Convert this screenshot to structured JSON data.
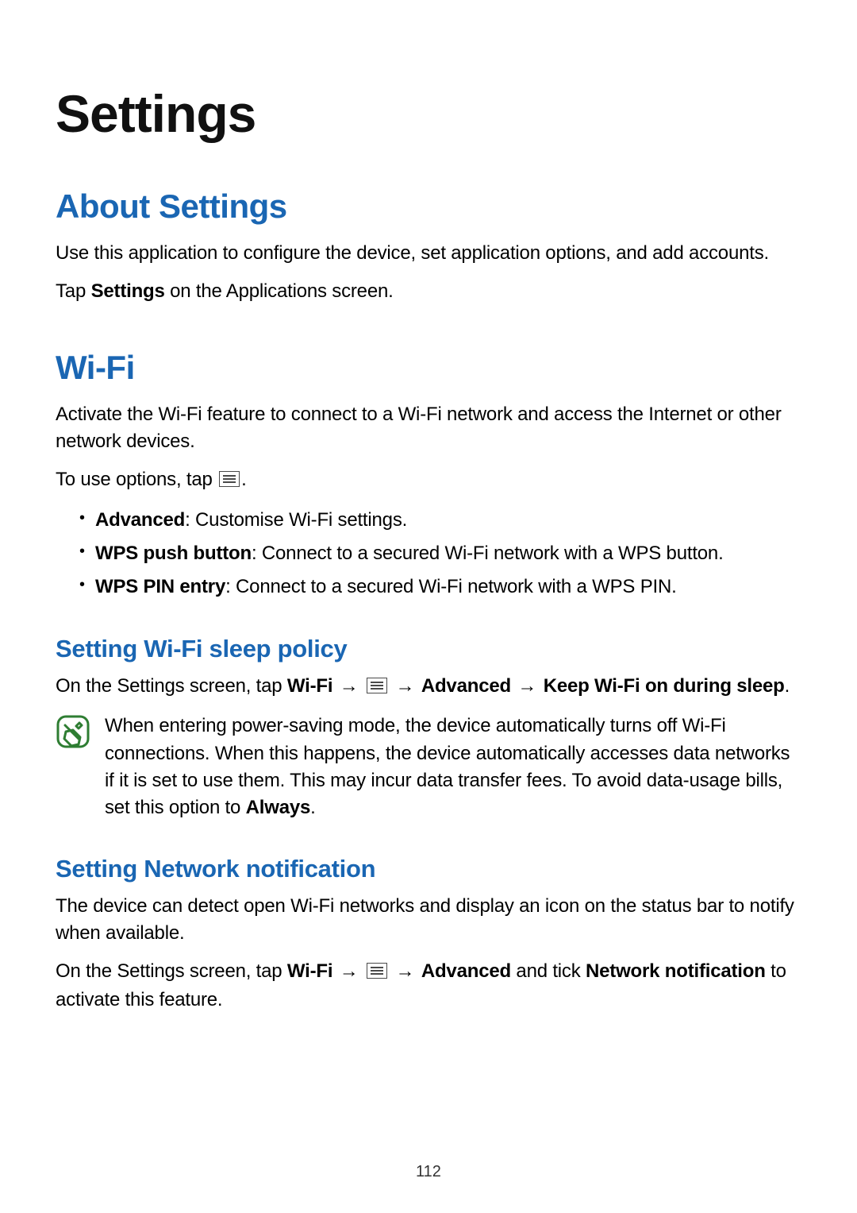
{
  "title": "Settings",
  "pageNumber": "112",
  "about": {
    "heading": "About Settings",
    "p1": "Use this application to configure the device, set application options, and add accounts.",
    "p2a": "Tap ",
    "p2b": "Settings",
    "p2c": " on the Applications screen."
  },
  "wifi": {
    "heading": "Wi-Fi",
    "p1": "Activate the Wi-Fi feature to connect to a Wi-Fi network and access the Internet or other network devices.",
    "p2a": "To use options, tap ",
    "p2b": ".",
    "options": [
      {
        "term": "Advanced",
        "desc": ": Customise Wi-Fi settings."
      },
      {
        "term": "WPS push button",
        "desc": ": Connect to a secured Wi-Fi network with a WPS button."
      },
      {
        "term": "WPS PIN entry",
        "desc": ": Connect to a secured Wi-Fi network with a WPS PIN."
      }
    ]
  },
  "sleep": {
    "heading": "Setting Wi-Fi sleep policy",
    "pre": "On the Settings screen, tap ",
    "wifi": "Wi-Fi",
    "arrow": " → ",
    "advanced": "Advanced",
    "keep": "Keep Wi-Fi on during sleep",
    "period": ".",
    "noteA": "When entering power-saving mode, the device automatically turns off Wi-Fi connections. When this happens, the device automatically accesses data networks if it is set to use them. This may incur data transfer fees. To avoid data-usage bills, set this option to ",
    "noteBold": "Always",
    "noteB": "."
  },
  "netnotif": {
    "heading": "Setting Network notification",
    "p1": "The device can detect open Wi-Fi networks and display an icon on the status bar to notify when available.",
    "pre": "On the Settings screen, tap ",
    "wifi": "Wi-Fi",
    "arrow": " → ",
    "advanced": "Advanced",
    "tick": " and tick ",
    "nn": "Network notification",
    "post": " to activate this feature."
  }
}
